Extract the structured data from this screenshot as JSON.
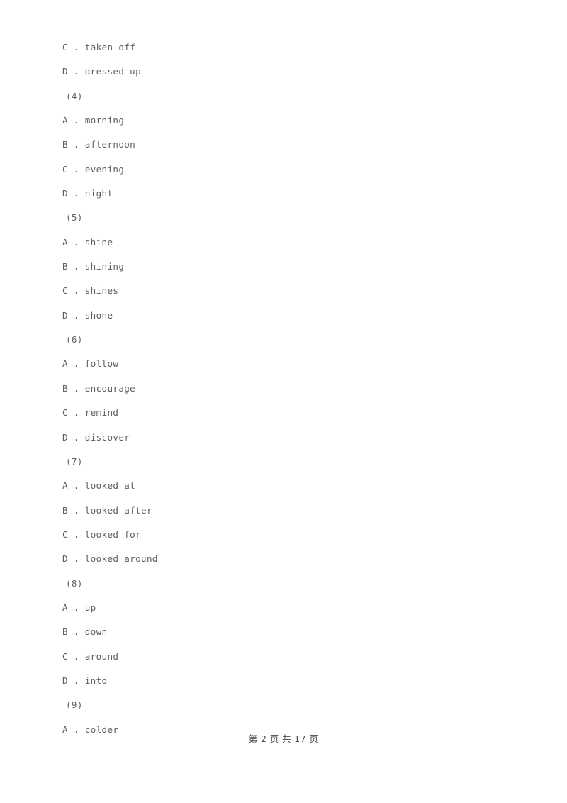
{
  "document": {
    "page_background": "#ffffff",
    "text_color": "#5e5e5e",
    "lines": [
      {
        "kind": "option",
        "text": "C . taken off"
      },
      {
        "kind": "option",
        "text": "D . dressed up"
      },
      {
        "kind": "qnum",
        "text": "(4)"
      },
      {
        "kind": "option",
        "text": "A . morning"
      },
      {
        "kind": "option",
        "text": "B . afternoon"
      },
      {
        "kind": "option",
        "text": "C . evening"
      },
      {
        "kind": "option",
        "text": "D . night"
      },
      {
        "kind": "qnum",
        "text": "(5)"
      },
      {
        "kind": "option",
        "text": "A . shine"
      },
      {
        "kind": "option",
        "text": "B . shining"
      },
      {
        "kind": "option",
        "text": "C . shines"
      },
      {
        "kind": "option",
        "text": "D . shone"
      },
      {
        "kind": "qnum",
        "text": "(6)"
      },
      {
        "kind": "option",
        "text": "A . follow"
      },
      {
        "kind": "option",
        "text": "B . encourage"
      },
      {
        "kind": "option",
        "text": "C . remind"
      },
      {
        "kind": "option",
        "text": "D . discover"
      },
      {
        "kind": "qnum",
        "text": "(7)"
      },
      {
        "kind": "option",
        "text": "A . looked at"
      },
      {
        "kind": "option",
        "text": "B . looked after"
      },
      {
        "kind": "option",
        "text": "C . looked for"
      },
      {
        "kind": "option",
        "text": "D . looked around"
      },
      {
        "kind": "qnum",
        "text": "(8)"
      },
      {
        "kind": "option",
        "text": "A . up"
      },
      {
        "kind": "option",
        "text": "B . down"
      },
      {
        "kind": "option",
        "text": "C . around"
      },
      {
        "kind": "option",
        "text": "D . into"
      },
      {
        "kind": "qnum",
        "text": "(9)"
      },
      {
        "kind": "option",
        "text": "A . colder"
      }
    ],
    "footer": {
      "text": "第 2 页 共 17 页",
      "page_number": "2",
      "total_pages": "17"
    }
  }
}
